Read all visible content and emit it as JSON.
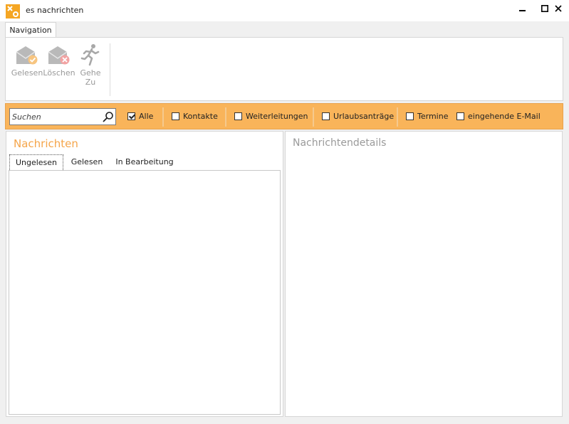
{
  "window": {
    "title": "es nachrichten",
    "icon": "app-logo-icon"
  },
  "ribbon": {
    "tab_label": "Navigation",
    "buttons": [
      {
        "label": "Gelesen",
        "icon": "mark-read-mail-icon"
      },
      {
        "label": "Löschen",
        "icon": "delete-mail-icon"
      },
      {
        "label": "Gehe\nZu",
        "icon": "running-man-icon"
      }
    ]
  },
  "filter": {
    "search_placeholder": "Suchen",
    "options": [
      {
        "label": "Alle",
        "checked": true
      },
      {
        "label": "Kontakte",
        "checked": false
      },
      {
        "label": "Weiterleitungen",
        "checked": false
      },
      {
        "label": "Urlaubsanträge",
        "checked": false
      },
      {
        "label": "Termine",
        "checked": false
      },
      {
        "label": "eingehende E-Mail",
        "checked": false
      }
    ]
  },
  "messages": {
    "title": "Nachrichten",
    "tabs": [
      "Ungelesen",
      "Gelesen",
      "In Bearbeitung"
    ],
    "active_tab": "Ungelesen"
  },
  "details": {
    "title": "Nachrichtendetails"
  },
  "colors": {
    "accent": "#f9b45a",
    "title_orange": "#f5a54a"
  }
}
